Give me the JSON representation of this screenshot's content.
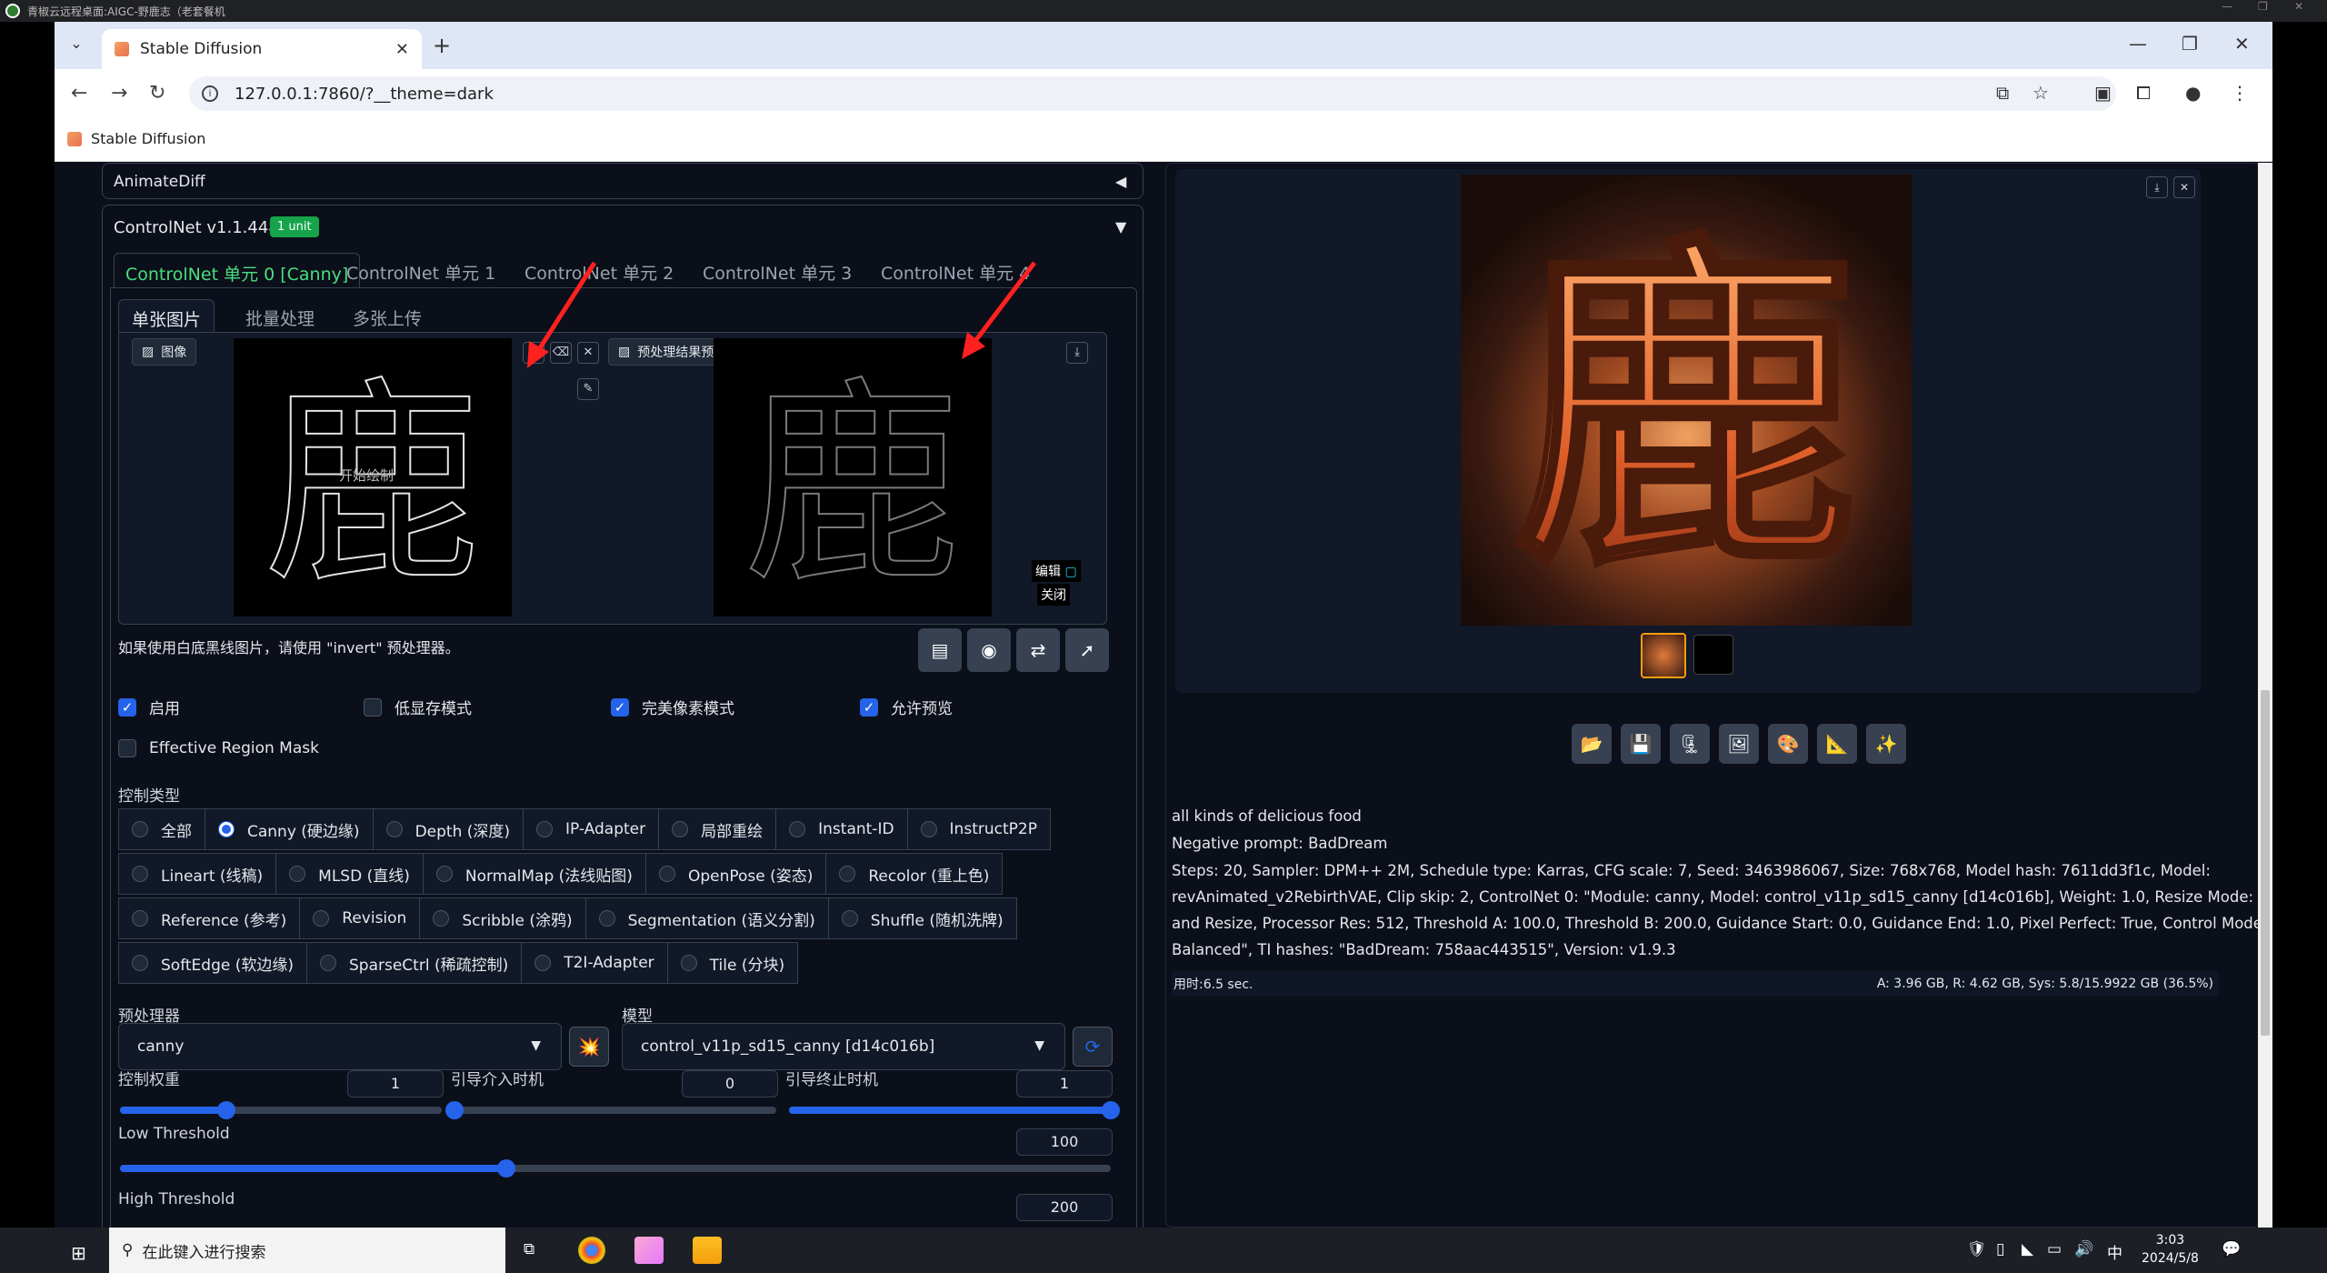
{
  "remote_title": "青椒云远程桌面:AIGC-野鹿志（老套餐机",
  "browser": {
    "tab_title": "Stable Diffusion",
    "url": "127.0.0.1:7860/?__theme=dark",
    "bookmark": "Stable Diffusion"
  },
  "animatediff": {
    "label": "AnimateDiff"
  },
  "controlnet": {
    "title": "ControlNet v1.1.448",
    "badge": "1 unit",
    "unit_tabs": [
      "ControlNet 单元 0 [Canny]",
      "ControlNet 单元 1",
      "ControlNet 单元 2",
      "ControlNet 单元 3",
      "ControlNet 单元 4"
    ],
    "sub_tabs": [
      "单张图片",
      "批量处理",
      "多张上传"
    ],
    "image_label": "图像",
    "preview_label": "预处理结果预览",
    "start_draw": "开始绘制",
    "edit_label": "编辑",
    "close_label": "关闭",
    "invert_hint": "如果使用白底黑线图片，请使用 \"invert\" 预处理器。",
    "checkboxes": [
      {
        "label": "启用",
        "checked": true
      },
      {
        "label": "低显存模式",
        "checked": false
      },
      {
        "label": "完美像素模式",
        "checked": true
      },
      {
        "label": "允许预览",
        "checked": true
      }
    ],
    "region_mask": "Effective Region Mask",
    "control_type_label": "控制类型",
    "control_types": [
      [
        "全部",
        "Canny (硬边缘)",
        "Depth (深度)",
        "IP-Adapter",
        "局部重绘",
        "Instant-ID",
        "InstructP2P"
      ],
      [
        "Lineart (线稿)",
        "MLSD (直线)",
        "NormalMap (法线贴图)",
        "OpenPose (姿态)",
        "Recolor (重上色)"
      ],
      [
        "Reference (参考)",
        "Revision",
        "Scribble (涂鸦)",
        "Segmentation (语义分割)",
        "Shuffle (随机洗牌)"
      ],
      [
        "SoftEdge (软边缘)",
        "SparseCtrl (稀疏控制)",
        "T2I-Adapter",
        "Tile (分块)"
      ]
    ],
    "selected_type": "Canny (硬边缘)",
    "preprocessor_label": "预处理器",
    "preprocessor_value": "canny",
    "model_label": "模型",
    "model_value": "control_v11p_sd15_canny [d14c016b]",
    "weight_label": "控制权重",
    "weight_value": "1",
    "start_label": "引导介入时机",
    "start_value": "0",
    "end_label": "引导终止时机",
    "end_value": "1",
    "low_threshold_label": "Low Threshold",
    "low_threshold_value": "100",
    "high_threshold_label": "High Threshold",
    "high_threshold_value": "200",
    "weight_level": 0.33,
    "start_level": 0.0,
    "end_level": 1.0,
    "low_level": 0.39
  },
  "output": {
    "result_glyph": "鹿",
    "prompt": "all kinds of delicious food",
    "negative": "Negative prompt: BadDream",
    "params_lines": [
      "Steps: 20, Sampler: DPM++ 2M, Schedule type: Karras, CFG scale: 7, Seed: 3463986067, Size: 768x768, Model hash: 7611dd3f1c, Model:",
      "revAnimated_v2RebirthVAE, Clip skip: 2, ControlNet 0: \"Module: canny, Model: control_v11p_sd15_canny [d14c016b], Weight: 1.0, Resize Mode: Crop",
      "and Resize, Processor Res: 512, Threshold A: 100.0, Threshold B: 200.0, Guidance Start: 0.0, Guidance End: 1.0, Pixel Perfect: True, Control Mode:",
      "Balanced\", TI hashes: \"BadDream: 758aac443515\", Version: v1.9.3"
    ],
    "time_used": "用时:6.5 sec.",
    "vram": "A: 3.96 GB, R: 4.62 GB, Sys: 5.8/15.9922 GB (36.5%)"
  },
  "taskbar": {
    "search_placeholder": "在此键入进行搜索",
    "time": "3:03",
    "date": "2024/5/8",
    "ime": "中"
  },
  "colors": {
    "accent": "#2563eb",
    "active_tab": "#4ade80",
    "badge": "#16a34a",
    "arrow": "#ff2020"
  }
}
